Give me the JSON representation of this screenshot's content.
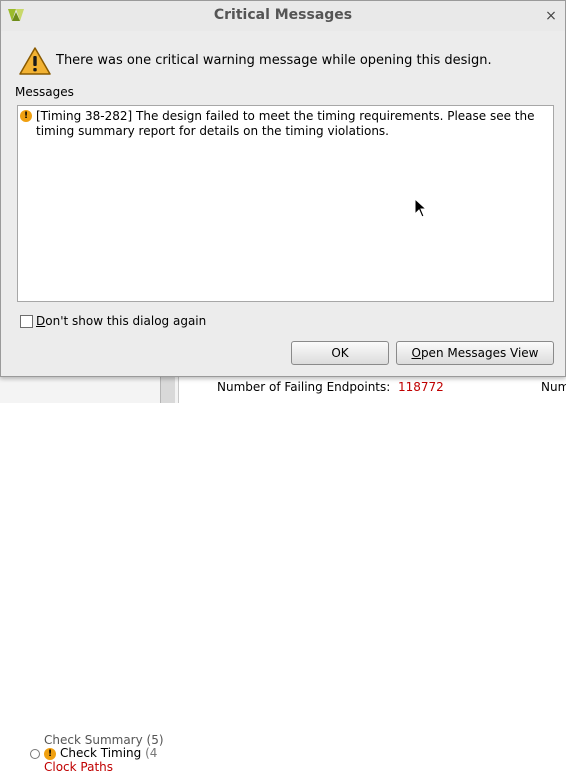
{
  "dialog": {
    "title": "Critical Messages",
    "close_glyph": "×",
    "intro_text": "There was one critical warning message while opening this design.",
    "messages_label": "Messages",
    "messages": [
      {
        "severity_icon": "critical-warning-icon",
        "text": "[Timing 38-282] The design failed to meet the timing requirements. Please see the timing summary report for details on the timing violations."
      }
    ],
    "checkbox": {
      "label_first": "D",
      "label_rest": "on't show this dialog again",
      "checked": false
    },
    "buttons": {
      "ok": "OK",
      "open_view_first": "O",
      "open_view_rest": "pen Messages View"
    }
  },
  "background": {
    "tree": {
      "row1": "Check Summary (5)",
      "row2_label": "Check Timing",
      "row2_count": "(4",
      "row3": "Clock Paths"
    },
    "metric_label": "Number of Failing Endpoints:",
    "metric_value": "118772",
    "metric_cut": "Num"
  },
  "colors": {
    "warning_accent": "#f0a010",
    "failure_red": "#c00000",
    "dialog_bg": "#ececec"
  }
}
